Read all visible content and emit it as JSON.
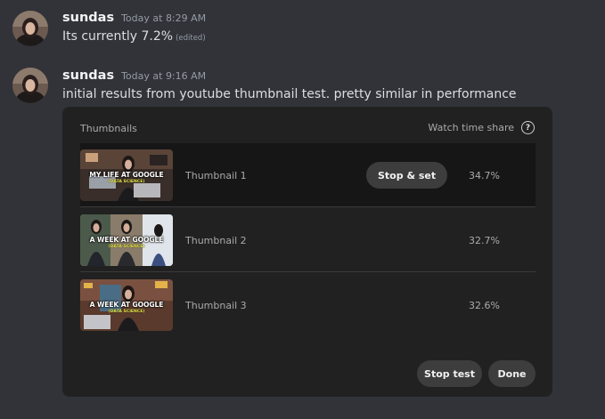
{
  "messages": [
    {
      "username": "sundas",
      "timestamp": "Today at 8:29 AM",
      "text": "Its currently 7.2%",
      "edited_label": "(edited)"
    },
    {
      "username": "sundas",
      "timestamp": "Today at 9:16 AM",
      "text": "initial results from youtube thumbnail test. pretty similar in performance"
    }
  ],
  "card": {
    "header_left": "Thumbnails",
    "header_right": "Watch time share",
    "help_glyph": "?",
    "rows": [
      {
        "label": "Thumbnail 1",
        "value": "34.7%",
        "action": "Stop & set",
        "thumb_title": "MY LIFE AT GOOGLE",
        "thumb_sub": "(DATA SCIENCE)"
      },
      {
        "label": "Thumbnail 2",
        "value": "32.7%",
        "thumb_title": "A WEEK AT GOOGLE",
        "thumb_sub": "(DATA SCIENCE)"
      },
      {
        "label": "Thumbnail 3",
        "value": "32.6%",
        "thumb_title": "A WEEK AT GOOGLE",
        "thumb_sub": "(DATA SCIENCE)"
      }
    ],
    "stop_test_label": "Stop test",
    "done_label": "Done"
  },
  "icons": {
    "help": "help-circle-icon"
  }
}
